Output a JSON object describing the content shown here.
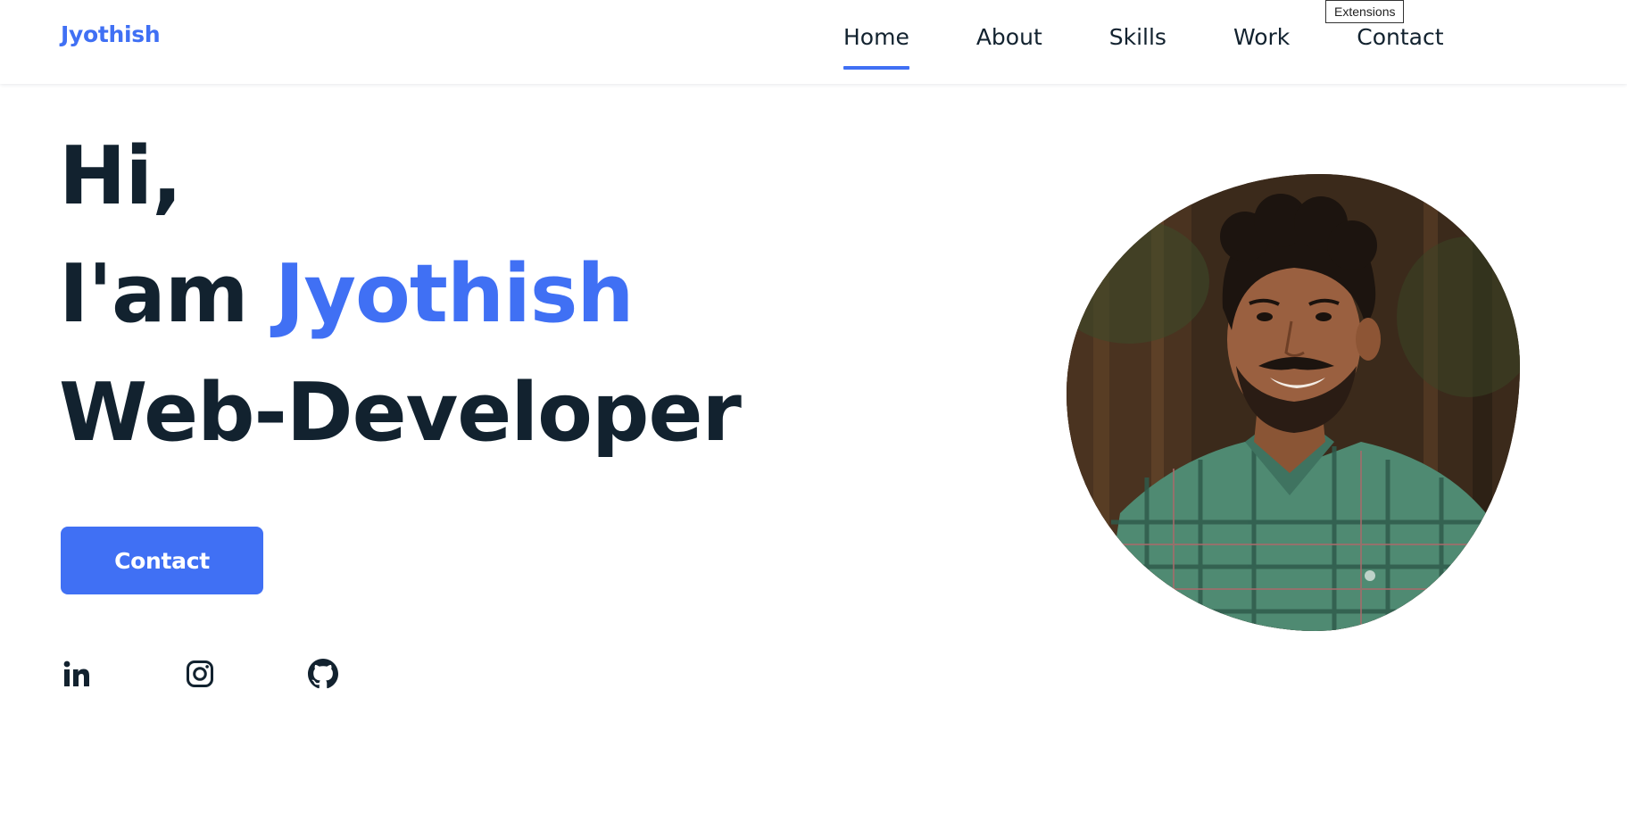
{
  "header": {
    "logo": "Jyothish",
    "nav": [
      {
        "label": "Home",
        "active": true
      },
      {
        "label": "About",
        "active": false
      },
      {
        "label": "Skills",
        "active": false
      },
      {
        "label": "Work",
        "active": false
      },
      {
        "label": "Contact",
        "active": false
      }
    ]
  },
  "tooltip": {
    "text": "Extensions"
  },
  "hero": {
    "greeting": "Hi,",
    "intro_prefix": "I'am",
    "name": "Jyothish",
    "role": "Web-Developer",
    "contact_button": "Contact"
  },
  "social": [
    {
      "icon": "linkedin-icon"
    },
    {
      "icon": "instagram-icon"
    },
    {
      "icon": "github-icon"
    }
  ],
  "colors": {
    "accent": "#4070f4",
    "text": "#12222f",
    "background": "#ffffff"
  }
}
